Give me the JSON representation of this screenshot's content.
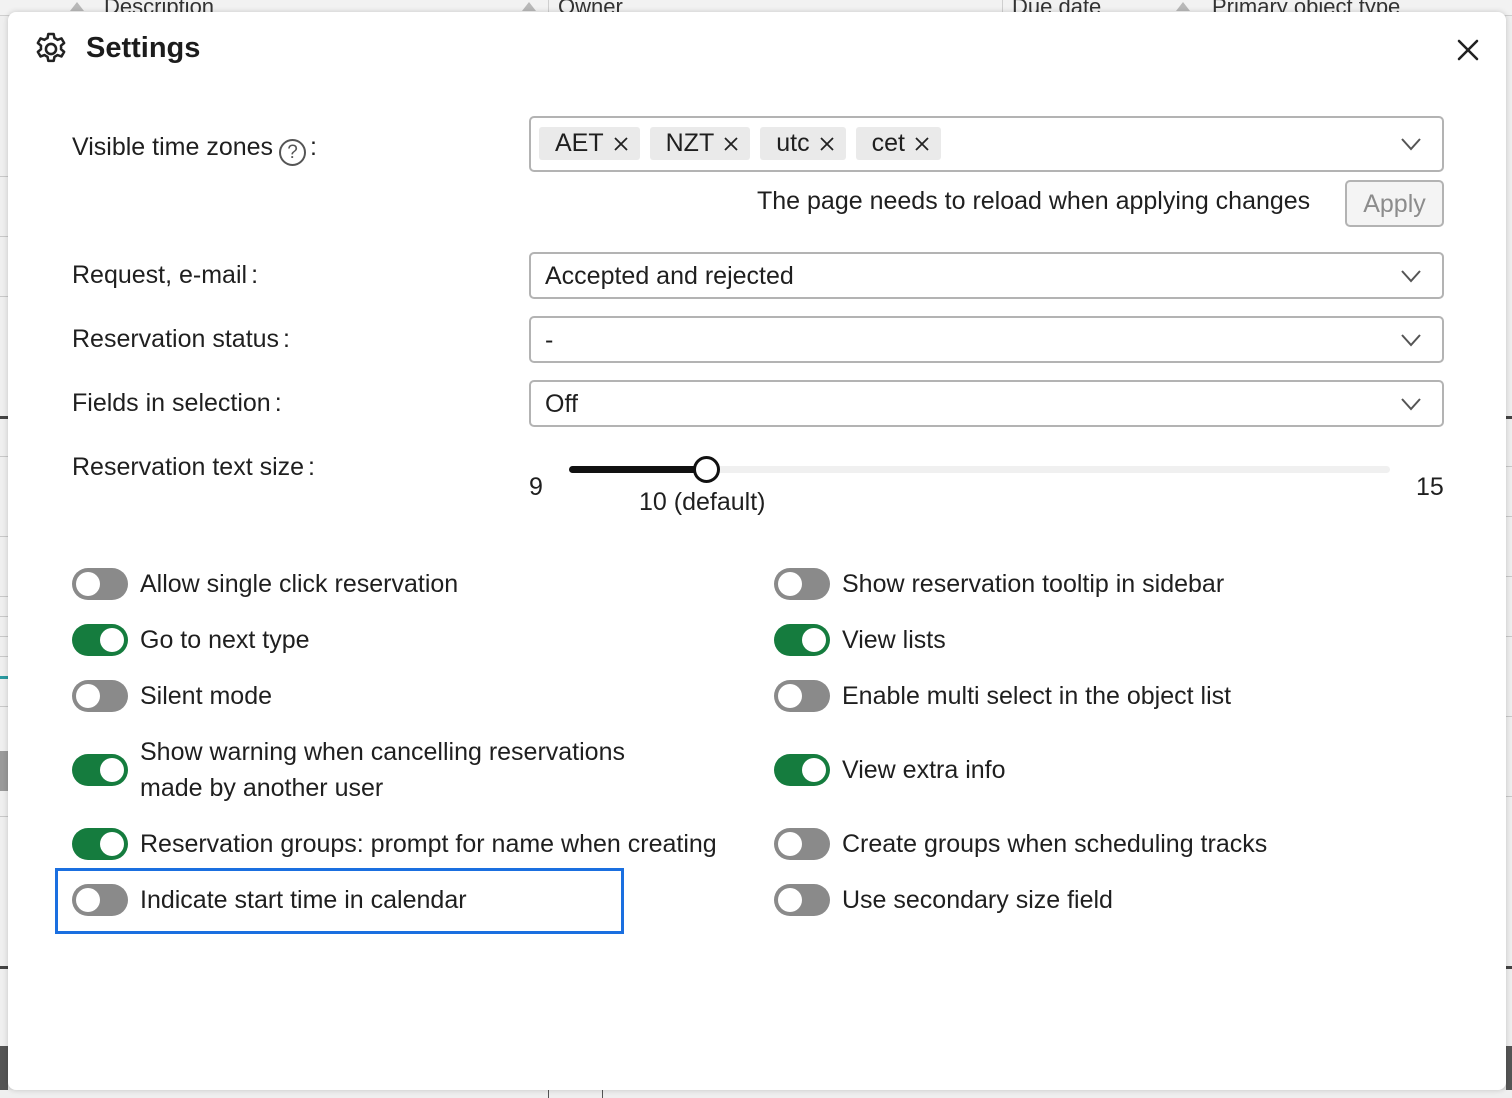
{
  "background_table": {
    "columns": [
      "Description",
      "Owner",
      "Due date",
      "Primary object type"
    ]
  },
  "dialog": {
    "title": "Settings",
    "title_icon": "gear-icon",
    "close_icon": "close-icon"
  },
  "time_zones": {
    "label": "Visible time zones",
    "help_glyph": "?",
    "colon": ":",
    "chips": [
      "AET",
      "NZT",
      "utc",
      "cet"
    ],
    "reload_note": "The page needs to reload when applying changes",
    "apply_label": "Apply"
  },
  "request_email": {
    "label": "Request, e-mail",
    "colon": ":",
    "value": "Accepted and rejected"
  },
  "reservation_status": {
    "label": "Reservation status",
    "colon": ":",
    "value": "-"
  },
  "fields_in_selection": {
    "label": "Fields in selection",
    "colon": ":",
    "value": "Off"
  },
  "text_size": {
    "label": "Reservation text size",
    "colon": ":",
    "min": "9",
    "max": "15",
    "current": 10,
    "value_label": "10 (default)"
  },
  "toggles_left": [
    {
      "label": "Allow single click reservation",
      "on": false
    },
    {
      "label": "Go to next type",
      "on": true
    },
    {
      "label": "Silent mode",
      "on": false
    },
    {
      "label": "Show warning when cancelling reservations made by another user",
      "on": true
    },
    {
      "label": "Reservation groups: prompt for name when creating",
      "on": true
    },
    {
      "label": "Indicate start time in calendar",
      "on": false
    }
  ],
  "toggles_right": [
    {
      "label": "Show reservation tooltip in sidebar",
      "on": false
    },
    {
      "label": "View lists",
      "on": true
    },
    {
      "label": "Enable multi select in the object list",
      "on": false
    },
    {
      "label": "View extra info",
      "on": true
    },
    {
      "label": "Create groups when scheduling tracks",
      "on": false
    },
    {
      "label": "Use secondary size field",
      "on": false
    }
  ],
  "colors": {
    "toggle_on": "#157c3e",
    "toggle_off": "#8a8a8a",
    "highlight": "#1a6fe0"
  }
}
